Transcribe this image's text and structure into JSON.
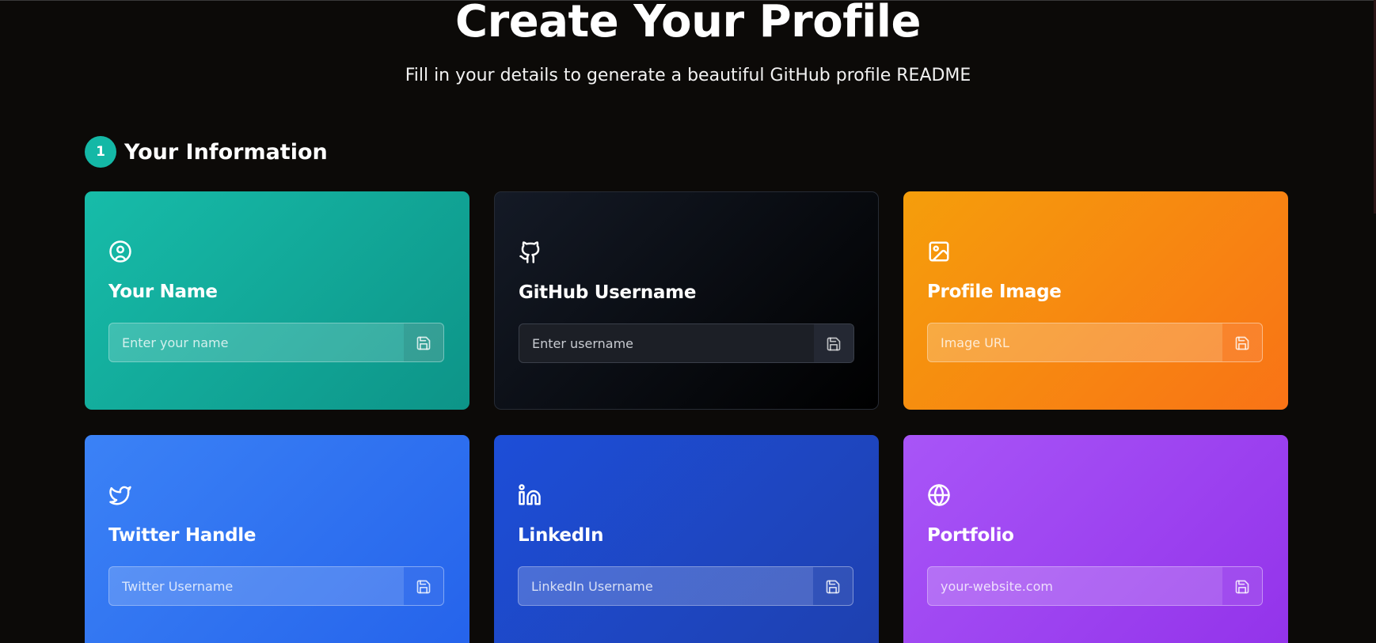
{
  "header": {
    "title": "Create Your Profile",
    "subtitle": "Fill in your details to generate a beautiful GitHub profile README"
  },
  "section": {
    "step": "1",
    "title": "Your Information"
  },
  "cards": [
    {
      "title": "Your Name",
      "placeholder": "Enter your name",
      "icon": "user-circle-icon",
      "color_from": "#17bca9",
      "color_to": "#0d9488"
    },
    {
      "title": "GitHub Username",
      "placeholder": "Enter username",
      "icon": "github-icon",
      "color_from": "#141a26",
      "color_to": "#000000"
    },
    {
      "title": "Profile Image",
      "placeholder": "Image URL",
      "icon": "image-icon",
      "color_from": "#f59e0b",
      "color_to": "#f97316"
    },
    {
      "title": "Twitter Handle",
      "placeholder": "Twitter Username",
      "icon": "twitter-icon",
      "color_from": "#3b82f6",
      "color_to": "#2563eb"
    },
    {
      "title": "LinkedIn",
      "placeholder": "LinkedIn Username",
      "icon": "linkedin-icon",
      "color_from": "#1d4ed8",
      "color_to": "#1e40af"
    },
    {
      "title": "Portfolio",
      "placeholder": "your-website.com",
      "icon": "globe-icon",
      "color_from": "#a855f7",
      "color_to": "#9333ea"
    }
  ],
  "save_icon": "save-icon",
  "accent_color": "#14b8a6"
}
